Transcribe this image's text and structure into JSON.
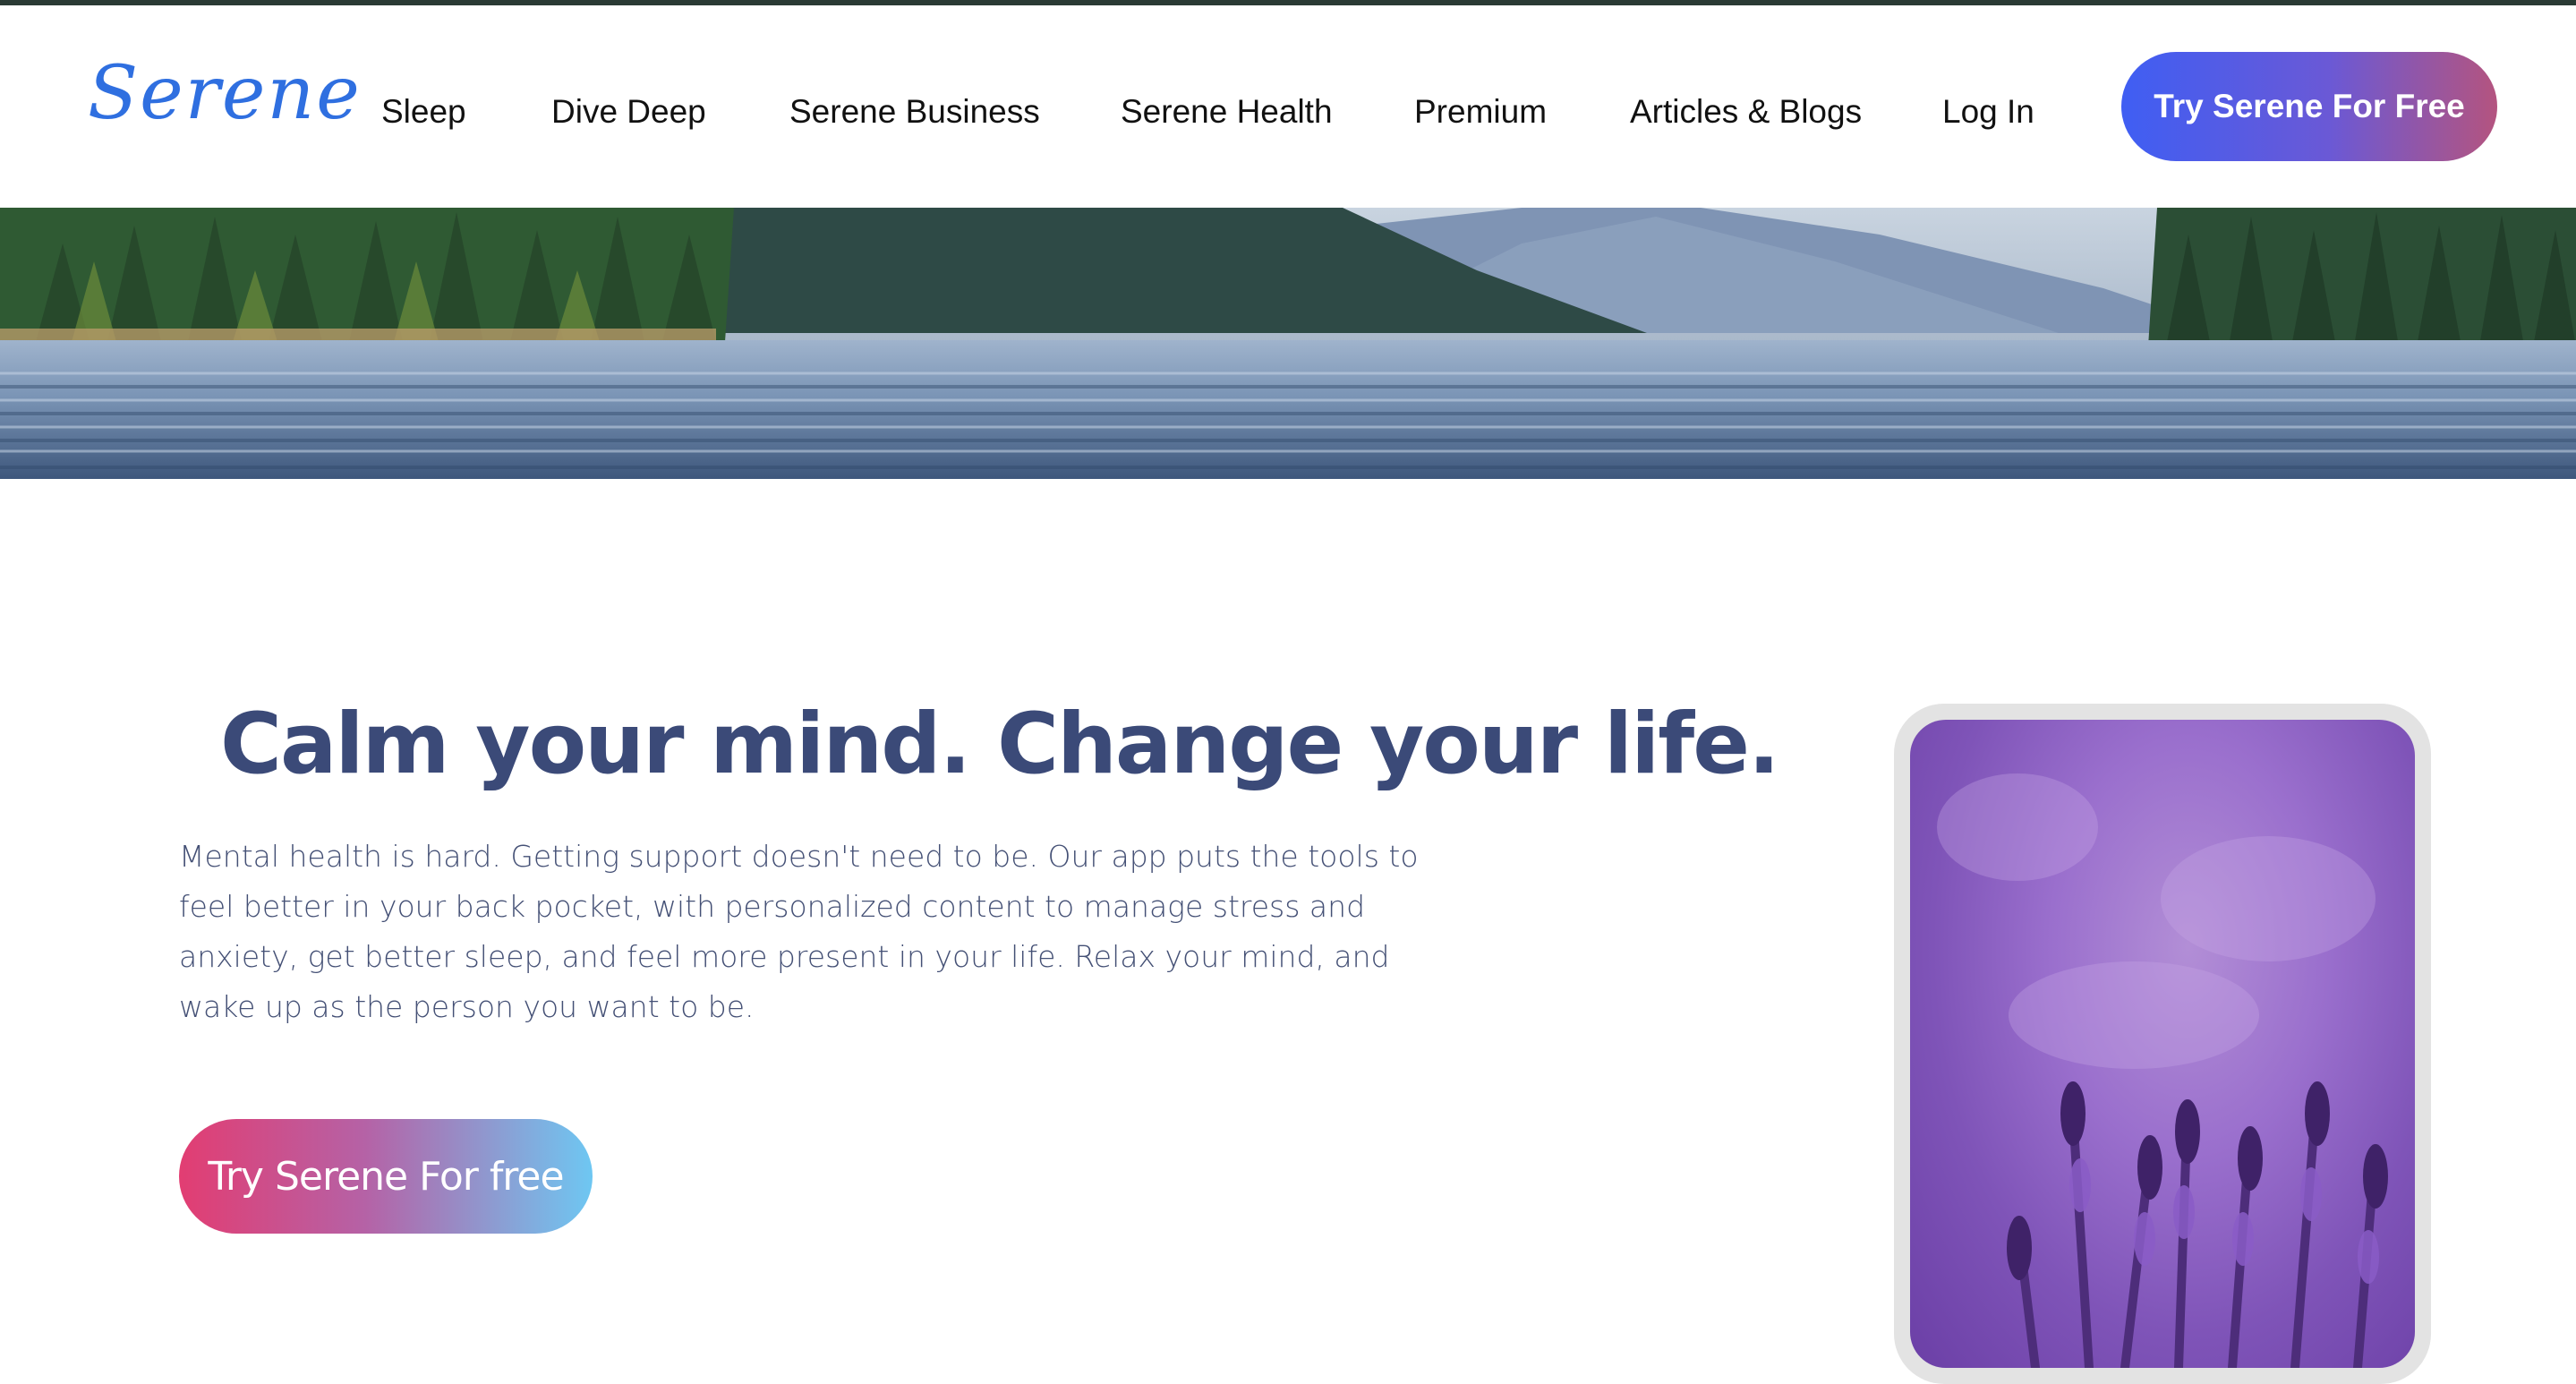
{
  "header": {
    "logo": "Serene",
    "nav": [
      {
        "label": "Sleep"
      },
      {
        "label": "Dive Deep"
      },
      {
        "label": "Serene Business"
      },
      {
        "label": "Serene Health"
      },
      {
        "label": "Premium"
      },
      {
        "label": "Articles & Blogs"
      },
      {
        "label": "Log In"
      }
    ],
    "cta_label": "Try Serene For Free"
  },
  "hero": {
    "headline": "Calm your mind. Change your life.",
    "body": "Mental health is hard. Getting support doesn't need to be. Our app puts the tools to feel better in your back pocket, with personalized content to manage stress and anxiety, get better sleep, and feel more present in your life. Relax your mind, and wake up as the person you want to be.",
    "cta_label": "Try Serene For free"
  },
  "colors": {
    "brand_blue": "#2f6fe0",
    "headline": "#3b4a78",
    "body_text": "#445075"
  }
}
